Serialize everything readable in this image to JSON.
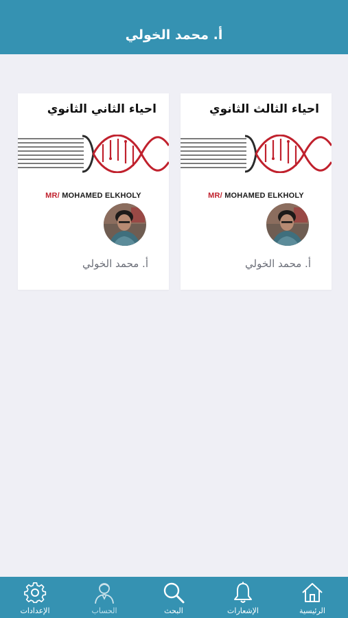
{
  "header": {
    "title": "أ. محمد الخولي"
  },
  "courses": [
    {
      "title": "احياء الثالث الثانوي",
      "brand_prefix": "MR/",
      "brand_name": "MOHAMED ELKHOLY",
      "teacher": "أ. محمد الخولي"
    },
    {
      "title": "احياء الثاني الثانوي",
      "brand_prefix": "MR/",
      "brand_name": "MOHAMED ELKHOLY",
      "teacher": "أ. محمد الخولي"
    }
  ],
  "tabs": [
    {
      "label": "الرئيسية",
      "icon": "home-icon",
      "active": true
    },
    {
      "label": "الإشعارات",
      "icon": "bell-icon",
      "active": true
    },
    {
      "label": "البحث",
      "icon": "search-icon",
      "active": true
    },
    {
      "label": "الحساب",
      "icon": "person-icon",
      "active": false
    },
    {
      "label": "الإعدادات",
      "icon": "gear-icon",
      "active": true
    }
  ],
  "colors": {
    "header": "#3592b2",
    "background": "#efeff5",
    "dna_red": "#c0212d",
    "brand_red": "#c0212d"
  }
}
